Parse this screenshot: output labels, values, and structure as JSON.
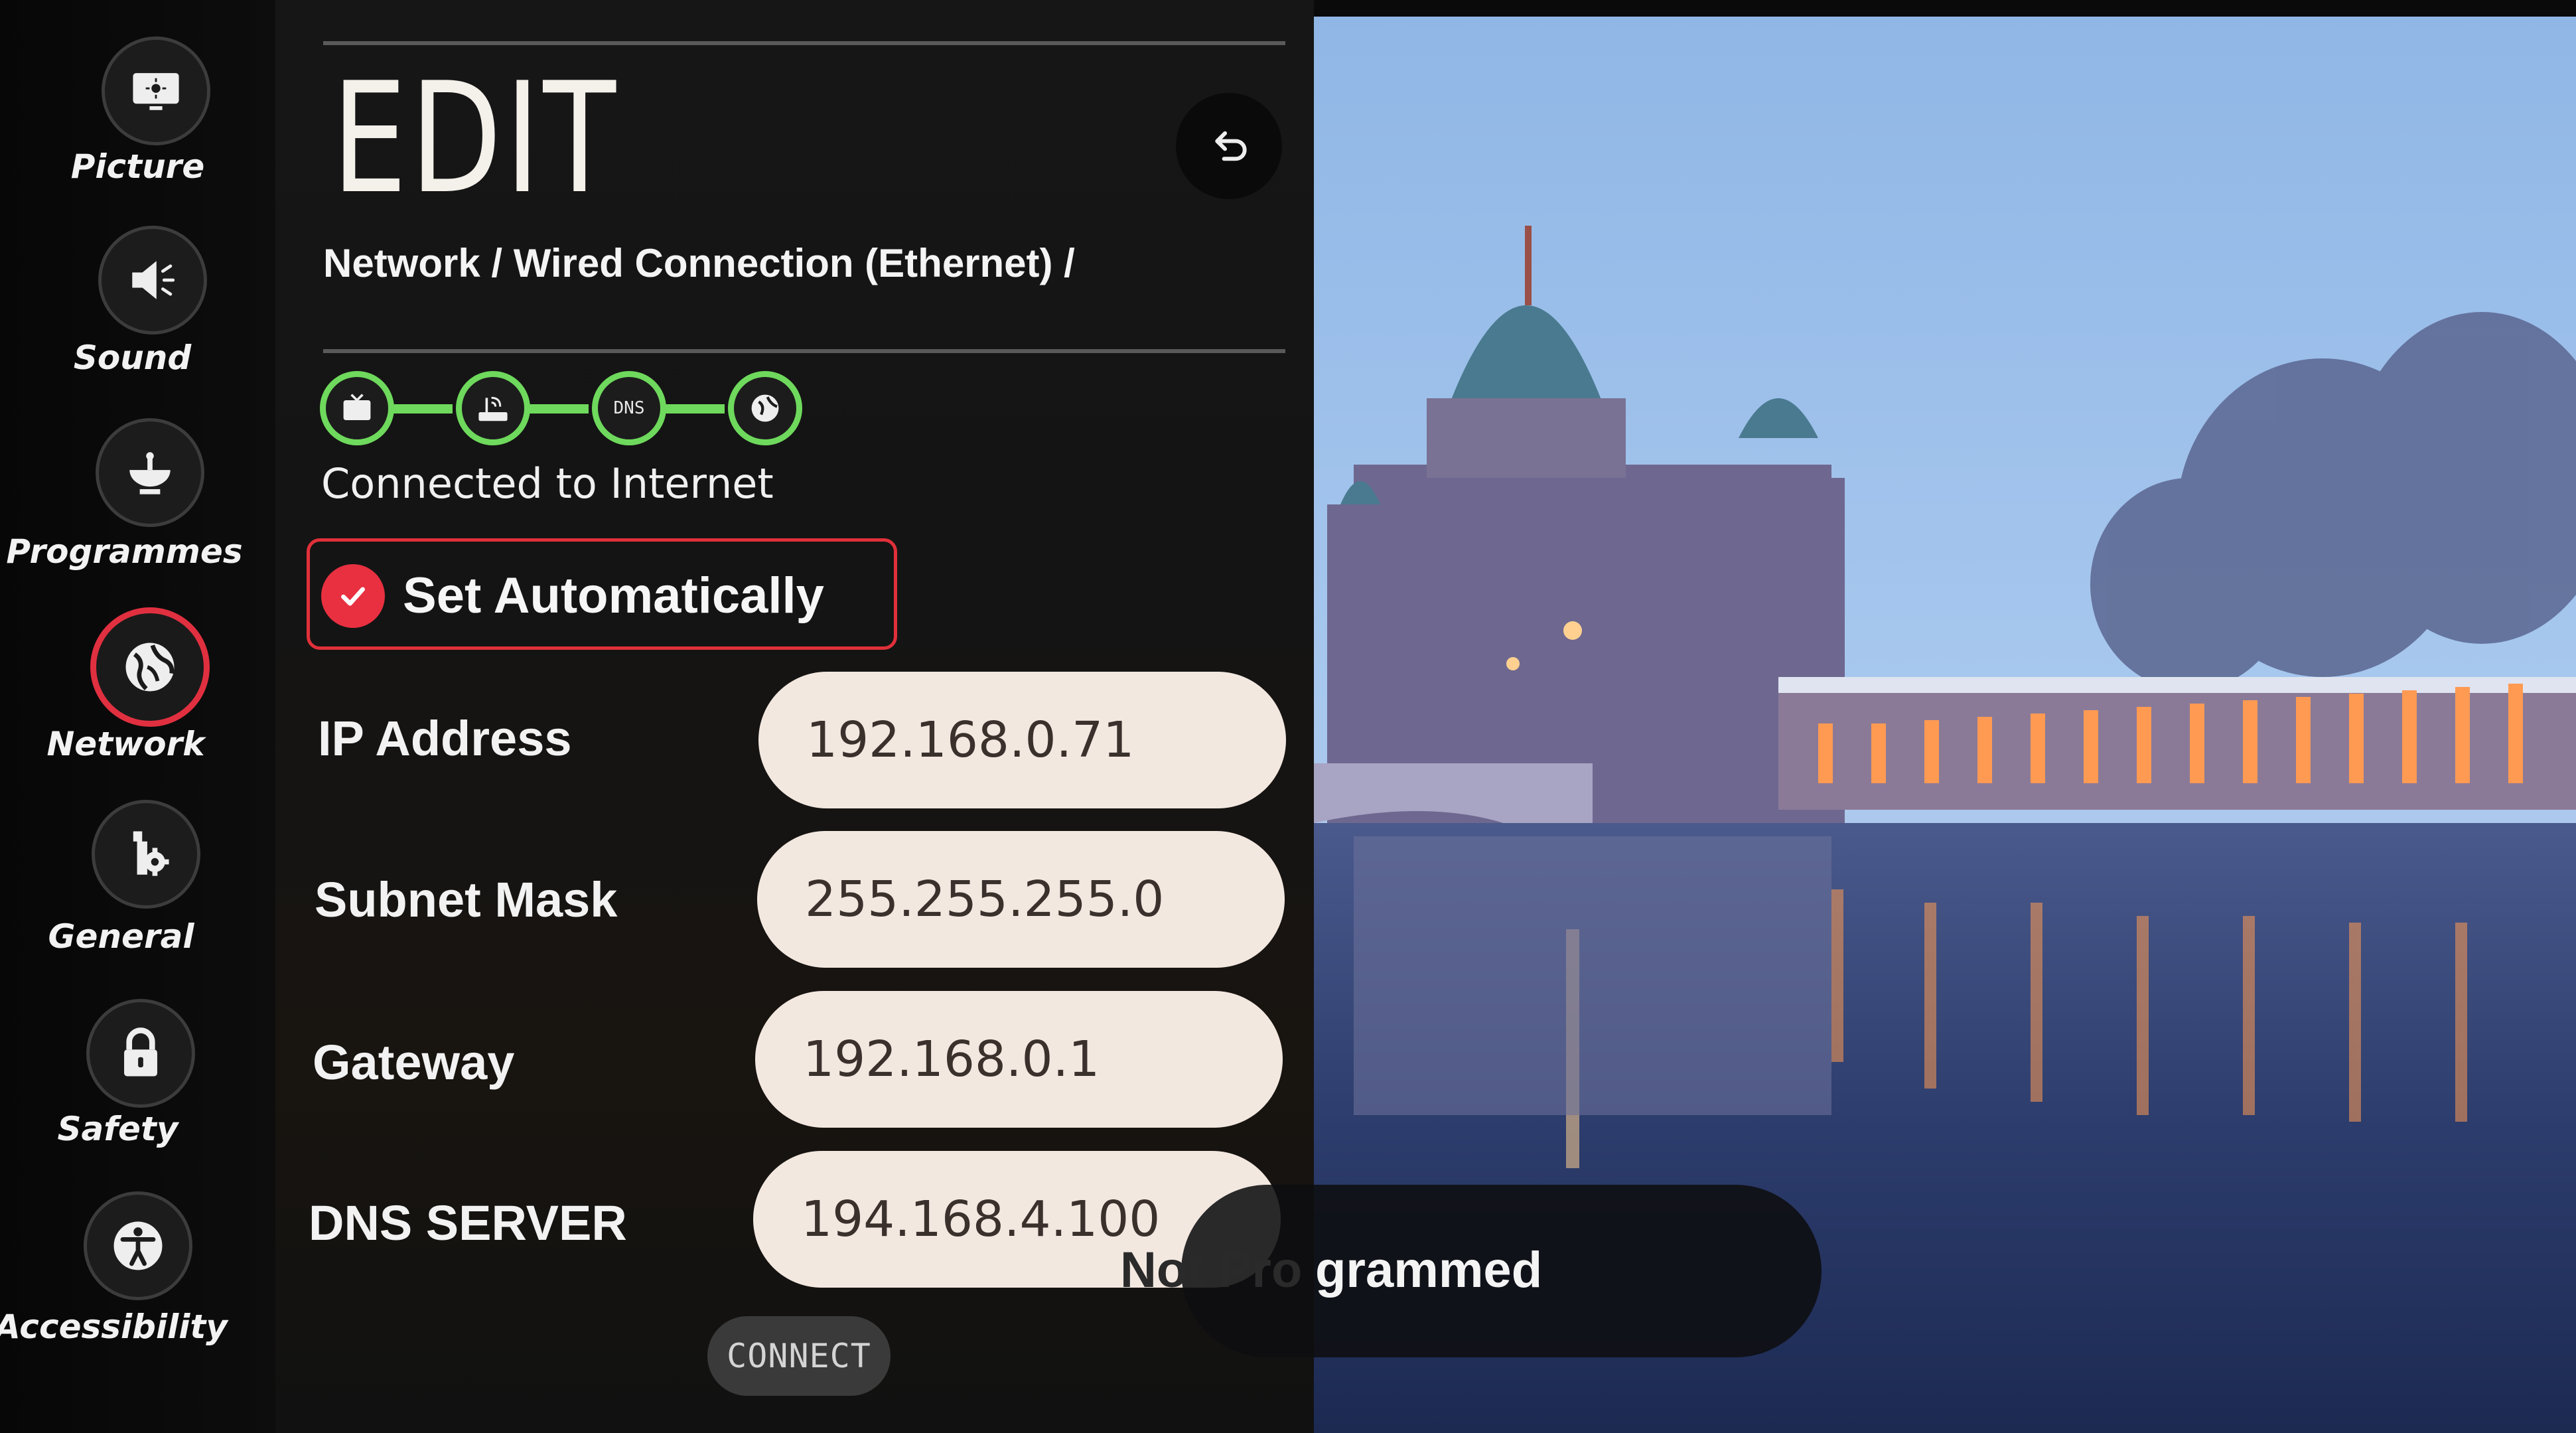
{
  "sidebar": {
    "items": [
      {
        "label": "Picture",
        "icon": "picture-icon"
      },
      {
        "label": "Sound",
        "icon": "speaker-icon"
      },
      {
        "label": "Programmes",
        "icon": "satellite-dish-icon"
      },
      {
        "label": "Network",
        "icon": "globe-icon",
        "active": true
      },
      {
        "label": "General",
        "icon": "wrench-gear-icon"
      },
      {
        "label": "Safety",
        "icon": "lock-icon"
      },
      {
        "label": "Accessibility",
        "icon": "accessibility-person-icon"
      }
    ]
  },
  "panel": {
    "title": "EDIT",
    "breadcrumb": "Network / Wired Connection (Ethernet) /",
    "back_icon": "back-arrow-icon",
    "status": {
      "nodes": [
        "tv-icon",
        "router-icon",
        "DNS",
        "globe-icon"
      ],
      "text": "Connected to Internet",
      "color": "#6ed95c"
    },
    "set_automatically": {
      "label": "Set Automatically",
      "checked": true,
      "accent": "#e83040"
    },
    "fields": [
      {
        "label": "IP Address",
        "value": "192.168.0.71"
      },
      {
        "label": "Subnet Mask",
        "value": "255.255.255.0"
      },
      {
        "label": "Gateway",
        "value": "192.168.0.1"
      },
      {
        "label": "DNS SERVER",
        "value": "194.168.4.100"
      }
    ],
    "connect_label": "CONNECT"
  },
  "toast": {
    "ghost_text": "Not Pro",
    "text": "grammed"
  }
}
